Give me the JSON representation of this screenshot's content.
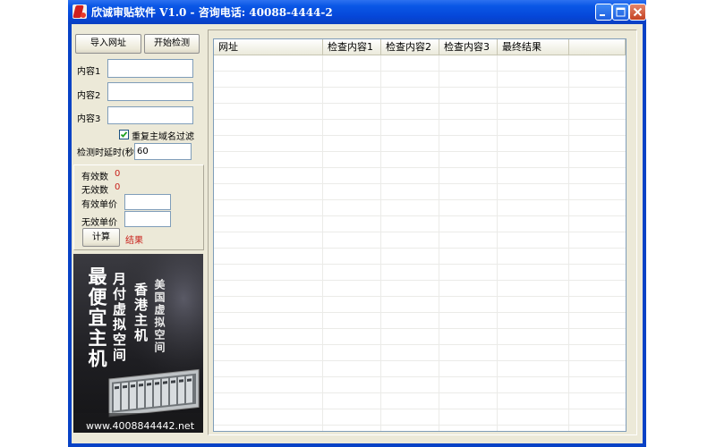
{
  "window": {
    "title": "欣诚审贴软件 V1.0 - 咨询电话: 40088-4444-2",
    "icon": "app-logo-icon"
  },
  "toolbar": {
    "import_label": "导入网址",
    "start_label": "开始检测"
  },
  "form": {
    "content1_label": "内容1",
    "content1_value": "",
    "content2_label": "内容2",
    "content2_value": "",
    "content3_label": "内容3",
    "content3_value": "",
    "dedupe_label": "重复主域名过滤",
    "dedupe_checked": true,
    "delay_label": "检测时延时(秒)",
    "delay_value": "60"
  },
  "stats": {
    "valid_label": "有效数",
    "valid_value": "0",
    "invalid_label": "无效数",
    "invalid_value": "0",
    "valid_price_label": "有效单价",
    "valid_price_value": "",
    "invalid_price_label": "无效单价",
    "invalid_price_value": "",
    "calc_label": "计算",
    "result_label": "结果"
  },
  "ad": {
    "line1": "最便宜主机",
    "line2": "月付虚拟空间",
    "line3": "香港主机",
    "line4": "美国虚拟空间",
    "url": "www.4008844442.net"
  },
  "table": {
    "columns": [
      "网址",
      "检查内容1",
      "检查内容2",
      "检查内容3",
      "最终结果",
      ""
    ],
    "rows": []
  },
  "colors": {
    "titlebar": "#0a57e6",
    "frame": "#0842c6",
    "face": "#ece9d8",
    "accent_red": "#c8201a"
  }
}
